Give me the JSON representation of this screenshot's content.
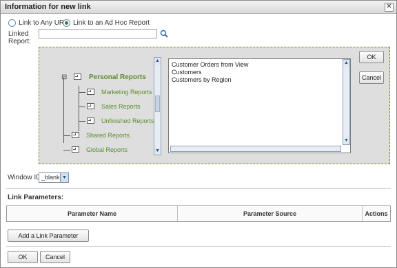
{
  "dialog": {
    "title": "Information for new link",
    "close_glyph": "✕"
  },
  "link_type": {
    "option_url": "Link to Any URL",
    "option_adhoc": "Link to an Ad Hoc Report",
    "selected": "Link to an Ad Hoc Report"
  },
  "linked_report": {
    "label_line1": "Linked",
    "label_line2": "Report:",
    "value": "",
    "search_icon": "search-icon"
  },
  "tree": {
    "root": "Personal Reports",
    "children": [
      "Marketing Reports",
      "Sales Reports",
      "Unfinished Reports"
    ],
    "siblings": [
      "Shared Reports",
      "Global Reports"
    ],
    "expander": "⊟"
  },
  "reports_list": [
    "Customer Orders from View",
    "Customers",
    "Customers by Region"
  ],
  "chooser_buttons": {
    "ok": "OK",
    "cancel": "Cancel"
  },
  "window_id": {
    "label": "Window ID:",
    "value": "_blank"
  },
  "link_parameters": {
    "section_label": "Link Parameters:",
    "columns": [
      "Parameter Name",
      "Parameter Source",
      "Actions"
    ],
    "rows": [],
    "add_button": "Add a Link Parameter"
  },
  "footer": {
    "ok": "OK",
    "cancel": "Cancel"
  },
  "colors": {
    "accent_green": "#5b8c2a",
    "chooser_border": "#6b8e23"
  }
}
